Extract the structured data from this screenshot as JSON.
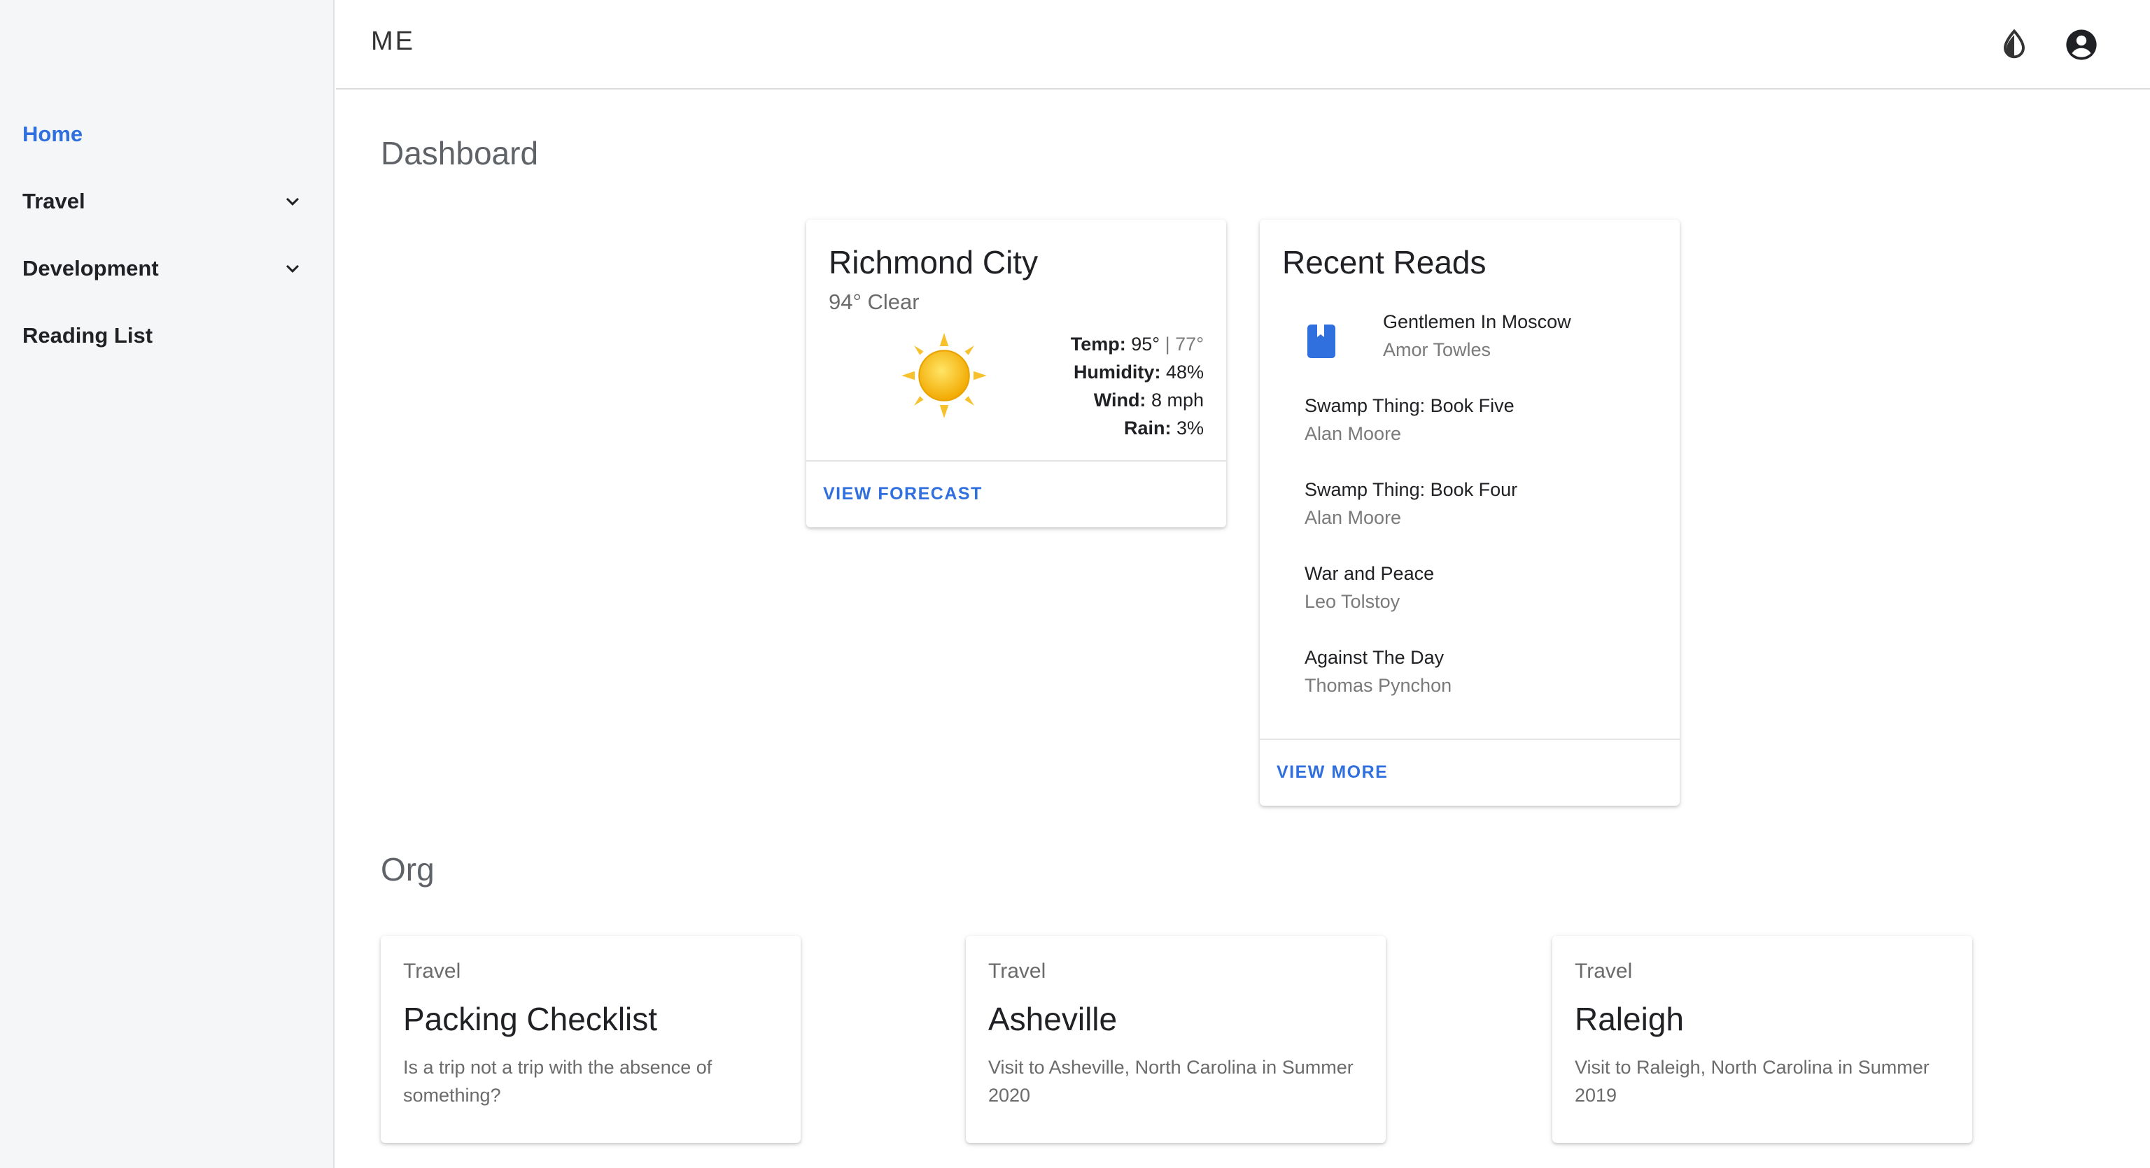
{
  "app": {
    "brand": "ME"
  },
  "sidebar": {
    "items": [
      {
        "label": "Home",
        "active": true,
        "expandable": false
      },
      {
        "label": "Travel",
        "active": false,
        "expandable": true
      },
      {
        "label": "Development",
        "active": false,
        "expandable": true
      },
      {
        "label": "Reading List",
        "active": false,
        "expandable": false
      }
    ]
  },
  "header": {
    "icons": [
      "theme-toggle-icon",
      "account-circle-icon"
    ]
  },
  "dashboard": {
    "title": "Dashboard",
    "weather": {
      "city": "Richmond City",
      "summary": "94° Clear",
      "icon": "sun-icon",
      "temp_label": "Temp:",
      "temp_high": "95°",
      "temp_sep": "|",
      "temp_low": "77°",
      "humidity_label": "Humidity:",
      "humidity": "48%",
      "wind_label": "Wind:",
      "wind": "8 mph",
      "rain_label": "Rain:",
      "rain": "3%",
      "action": "VIEW FORECAST"
    },
    "reads": {
      "title": "Recent Reads",
      "items": [
        {
          "title": "Gentlemen In Moscow",
          "author": "Amor Towles"
        },
        {
          "title": "Swamp Thing: Book Five",
          "author": "Alan Moore"
        },
        {
          "title": "Swamp Thing: Book Four",
          "author": "Alan Moore"
        },
        {
          "title": "War and Peace",
          "author": "Leo Tolstoy"
        },
        {
          "title": "Against The Day",
          "author": "Thomas Pynchon"
        }
      ],
      "action": "VIEW MORE"
    }
  },
  "org": {
    "title": "Org",
    "cards": [
      {
        "category": "Travel",
        "title": "Packing Checklist",
        "description": "Is a trip not a trip with the absence of something?"
      },
      {
        "category": "Travel",
        "title": "Asheville",
        "description": "Visit to Asheville, North Carolina in Summer 2020"
      },
      {
        "category": "Travel",
        "title": "Raleigh",
        "description": "Visit to Raleigh, North Carolina in Summer 2019"
      }
    ]
  },
  "colors": {
    "accent": "#2f6fde",
    "sidebar_bg": "#f5f6f8"
  }
}
